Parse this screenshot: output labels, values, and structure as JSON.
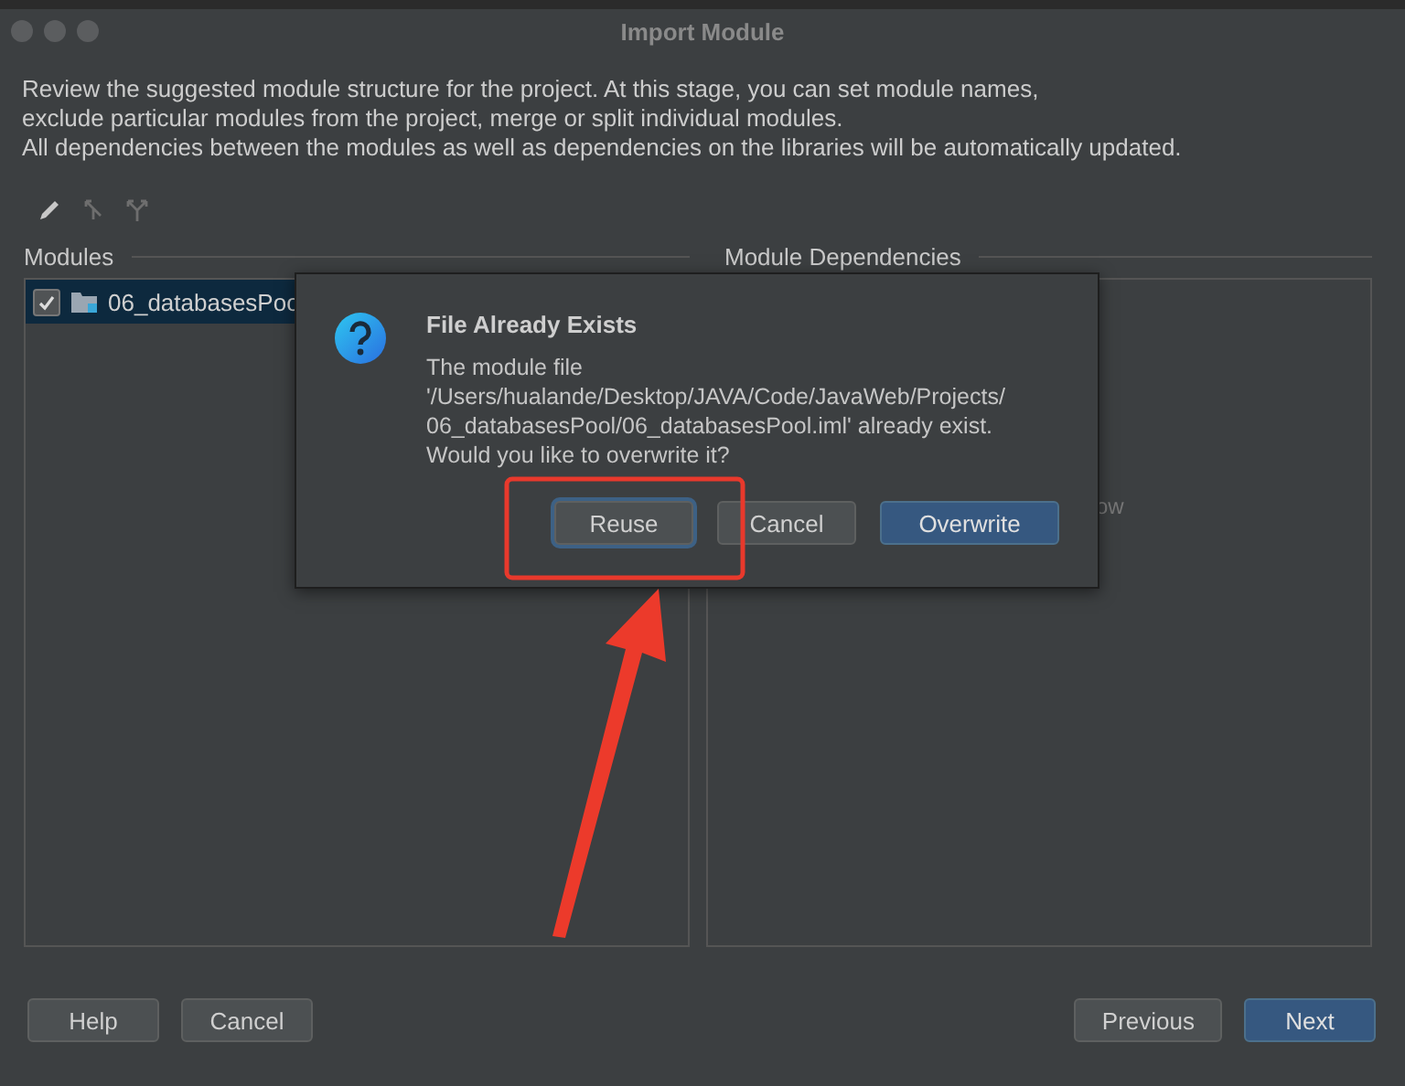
{
  "window": {
    "title": "Import Module"
  },
  "description": [
    "Review the suggested module structure for the project. At this stage, you can set module names,",
    "exclude particular modules from the project, merge or split individual modules.",
    "All dependencies between the modules as well as dependencies on the libraries will be automatically updated."
  ],
  "modules": {
    "title": "Modules",
    "items": [
      {
        "name": "06_databasesPoo",
        "checked": true,
        "selected": true
      }
    ]
  },
  "dependencies": {
    "title": "Module Dependencies",
    "hint_fragment": "ow"
  },
  "dialog": {
    "title": "File Already Exists",
    "message": [
      "The module file",
      "'/Users/hualande/Desktop/JAVA/Code/JavaWeb/Projects/",
      "06_databasesPool/06_databasesPool.iml' already exist.",
      "Would you like to overwrite it?"
    ],
    "buttons": [
      {
        "label": "Reuse",
        "kind": "focused"
      },
      {
        "label": "Cancel",
        "kind": "plain"
      },
      {
        "label": "Overwrite",
        "kind": "primary"
      }
    ]
  },
  "footer": {
    "left": [
      "Help",
      "Cancel"
    ],
    "right": [
      {
        "label": "Previous",
        "kind": "plain"
      },
      {
        "label": "Next",
        "kind": "primary"
      }
    ]
  }
}
